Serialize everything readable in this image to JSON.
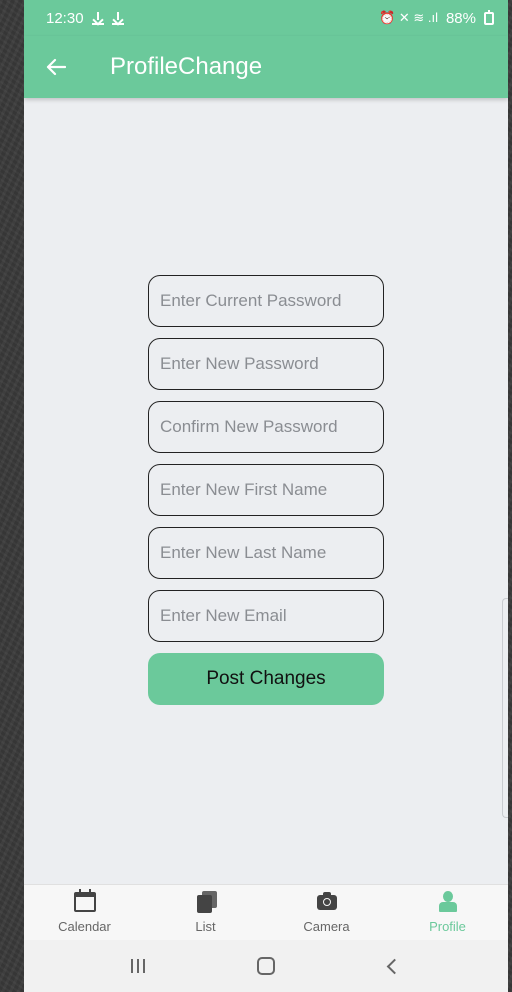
{
  "status_bar": {
    "time": "12:30",
    "indicators": "⏰ ✕ ≋ .ıl",
    "battery": "88%"
  },
  "app_bar": {
    "back_icon": "arrow-left-icon",
    "title": "ProfileChange"
  },
  "form": {
    "current_password_placeholder": "Enter Current Password",
    "new_password_placeholder": "Enter New Password",
    "confirm_password_placeholder": "Confirm New Password",
    "first_name_placeholder": "Enter New First Name",
    "last_name_placeholder": "Enter New Last Name",
    "email_placeholder": "Enter New Email",
    "submit_label": "Post Changes"
  },
  "bottom_nav": {
    "tabs": [
      {
        "label": "Calendar",
        "icon": "calendar-icon"
      },
      {
        "label": "List",
        "icon": "list-icon"
      },
      {
        "label": "Camera",
        "icon": "camera-icon"
      },
      {
        "label": "Profile",
        "icon": "person-icon"
      }
    ],
    "active_tab": "Profile"
  },
  "colors": {
    "accent": "#6bc99b",
    "background": "#eceef1",
    "field_border": "#222222"
  }
}
